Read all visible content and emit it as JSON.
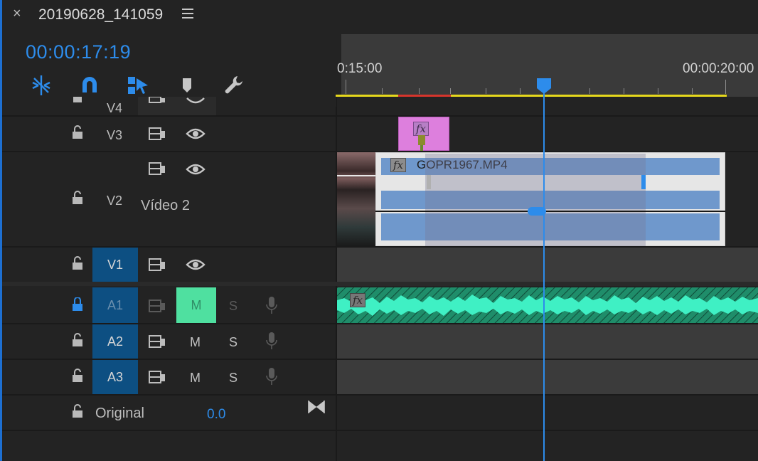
{
  "header": {
    "close_glyph": "×",
    "sequence_title": "20190628_141059"
  },
  "playhead": {
    "timecode": "00:00:17:19"
  },
  "toolbar": {
    "tools": [
      "insert-overwrite-icon",
      "snap-magnet-icon",
      "linked-selection-icon",
      "add-marker-icon",
      "timeline-settings-wrench-icon"
    ]
  },
  "ruler": {
    "labels": [
      "0:15:00",
      "00:00:20:00"
    ]
  },
  "tracks": {
    "v4": {
      "name": "V4"
    },
    "v3": {
      "name": "V3"
    },
    "v2": {
      "name": "V2",
      "display_name": "Vídeo 2"
    },
    "v1": {
      "name": "V1"
    },
    "a1": {
      "name": "A1",
      "mute": "M",
      "solo": "S"
    },
    "a2": {
      "name": "A2",
      "mute": "M",
      "solo": "S"
    },
    "a3": {
      "name": "A3",
      "mute": "M",
      "solo": "S"
    },
    "master": {
      "name": "Original",
      "volume": "0.0"
    }
  },
  "clips": {
    "v3_clip": {
      "fx": "fx"
    },
    "v2_clip": {
      "fx": "fx",
      "name": "GOPR1967.MP4"
    },
    "a1_clip": {
      "fx": "fx"
    }
  },
  "colors": {
    "accent": "#2d8ceb",
    "track_target": "#0d4f82",
    "work_area": "#e6d81c",
    "render_red": "#d6352c",
    "adjustment_clip": "#dd7fdd",
    "video_clip": "#6f98cc",
    "audio_clip": "#2fd8a8",
    "mute_active": "#4fe0a0"
  }
}
